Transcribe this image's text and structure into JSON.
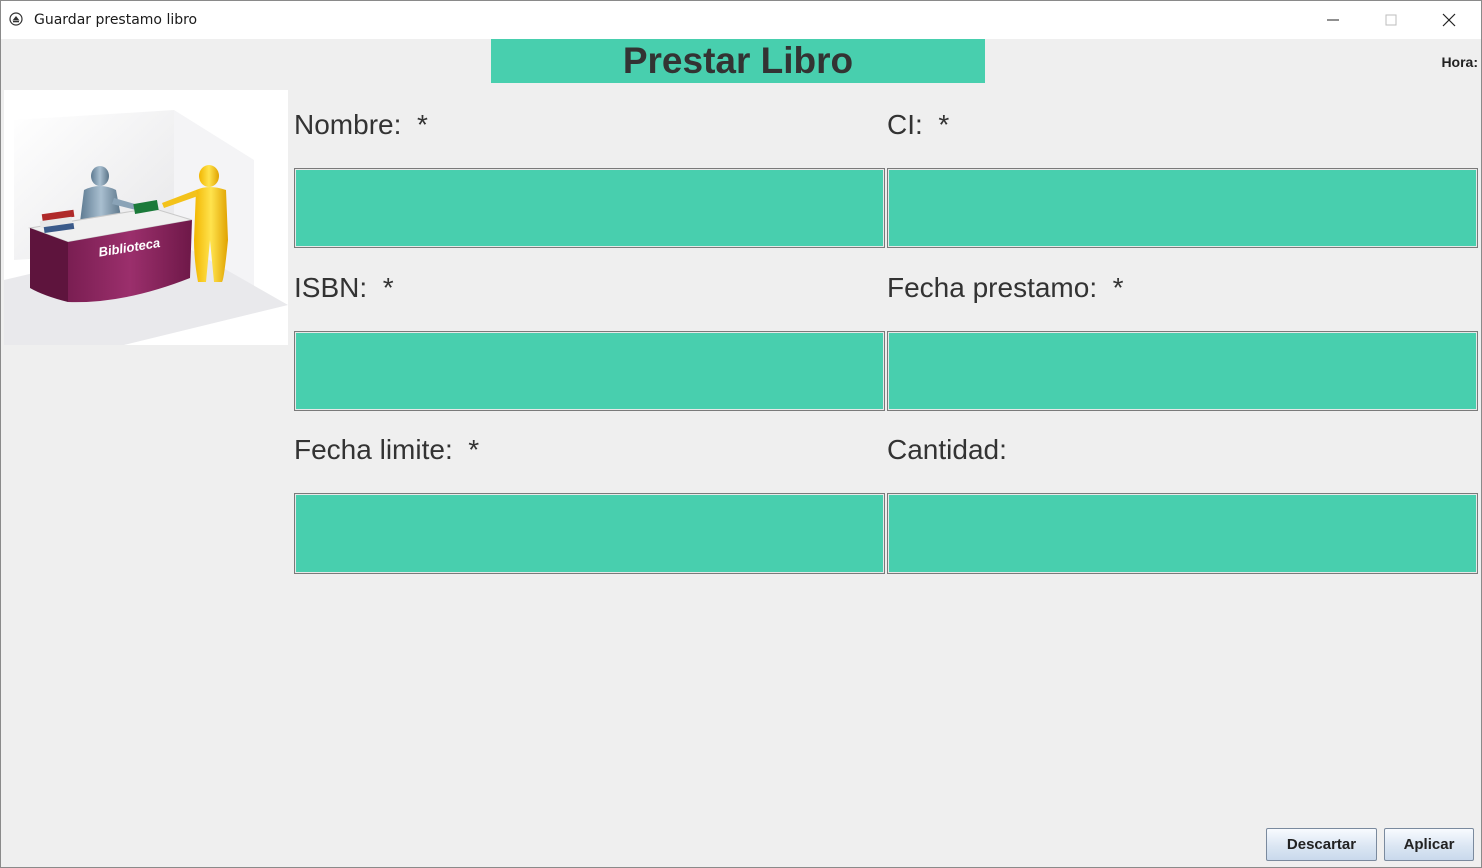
{
  "window": {
    "title": "Guardar prestamo libro"
  },
  "header": {
    "title": "Prestar Libro",
    "hora_label": "Hora:"
  },
  "illustration": {
    "desk_text": "Biblioteca"
  },
  "form": {
    "nombre": {
      "label": "Nombre:",
      "required": "*",
      "value": ""
    },
    "ci": {
      "label": "CI:",
      "required": "*",
      "value": ""
    },
    "isbn": {
      "label": "ISBN:",
      "required": "*",
      "value": ""
    },
    "fecha_prestamo": {
      "label": "Fecha prestamo:",
      "required": "*",
      "value": ""
    },
    "fecha_limite": {
      "label": "Fecha limite:",
      "required": "*",
      "value": ""
    },
    "cantidad": {
      "label": "Cantidad:",
      "value": ""
    }
  },
  "actions": {
    "descartar": "Descartar",
    "aplicar": "Aplicar"
  },
  "colors": {
    "accent": "#48cfae",
    "background": "#efefef",
    "text": "#333333"
  }
}
